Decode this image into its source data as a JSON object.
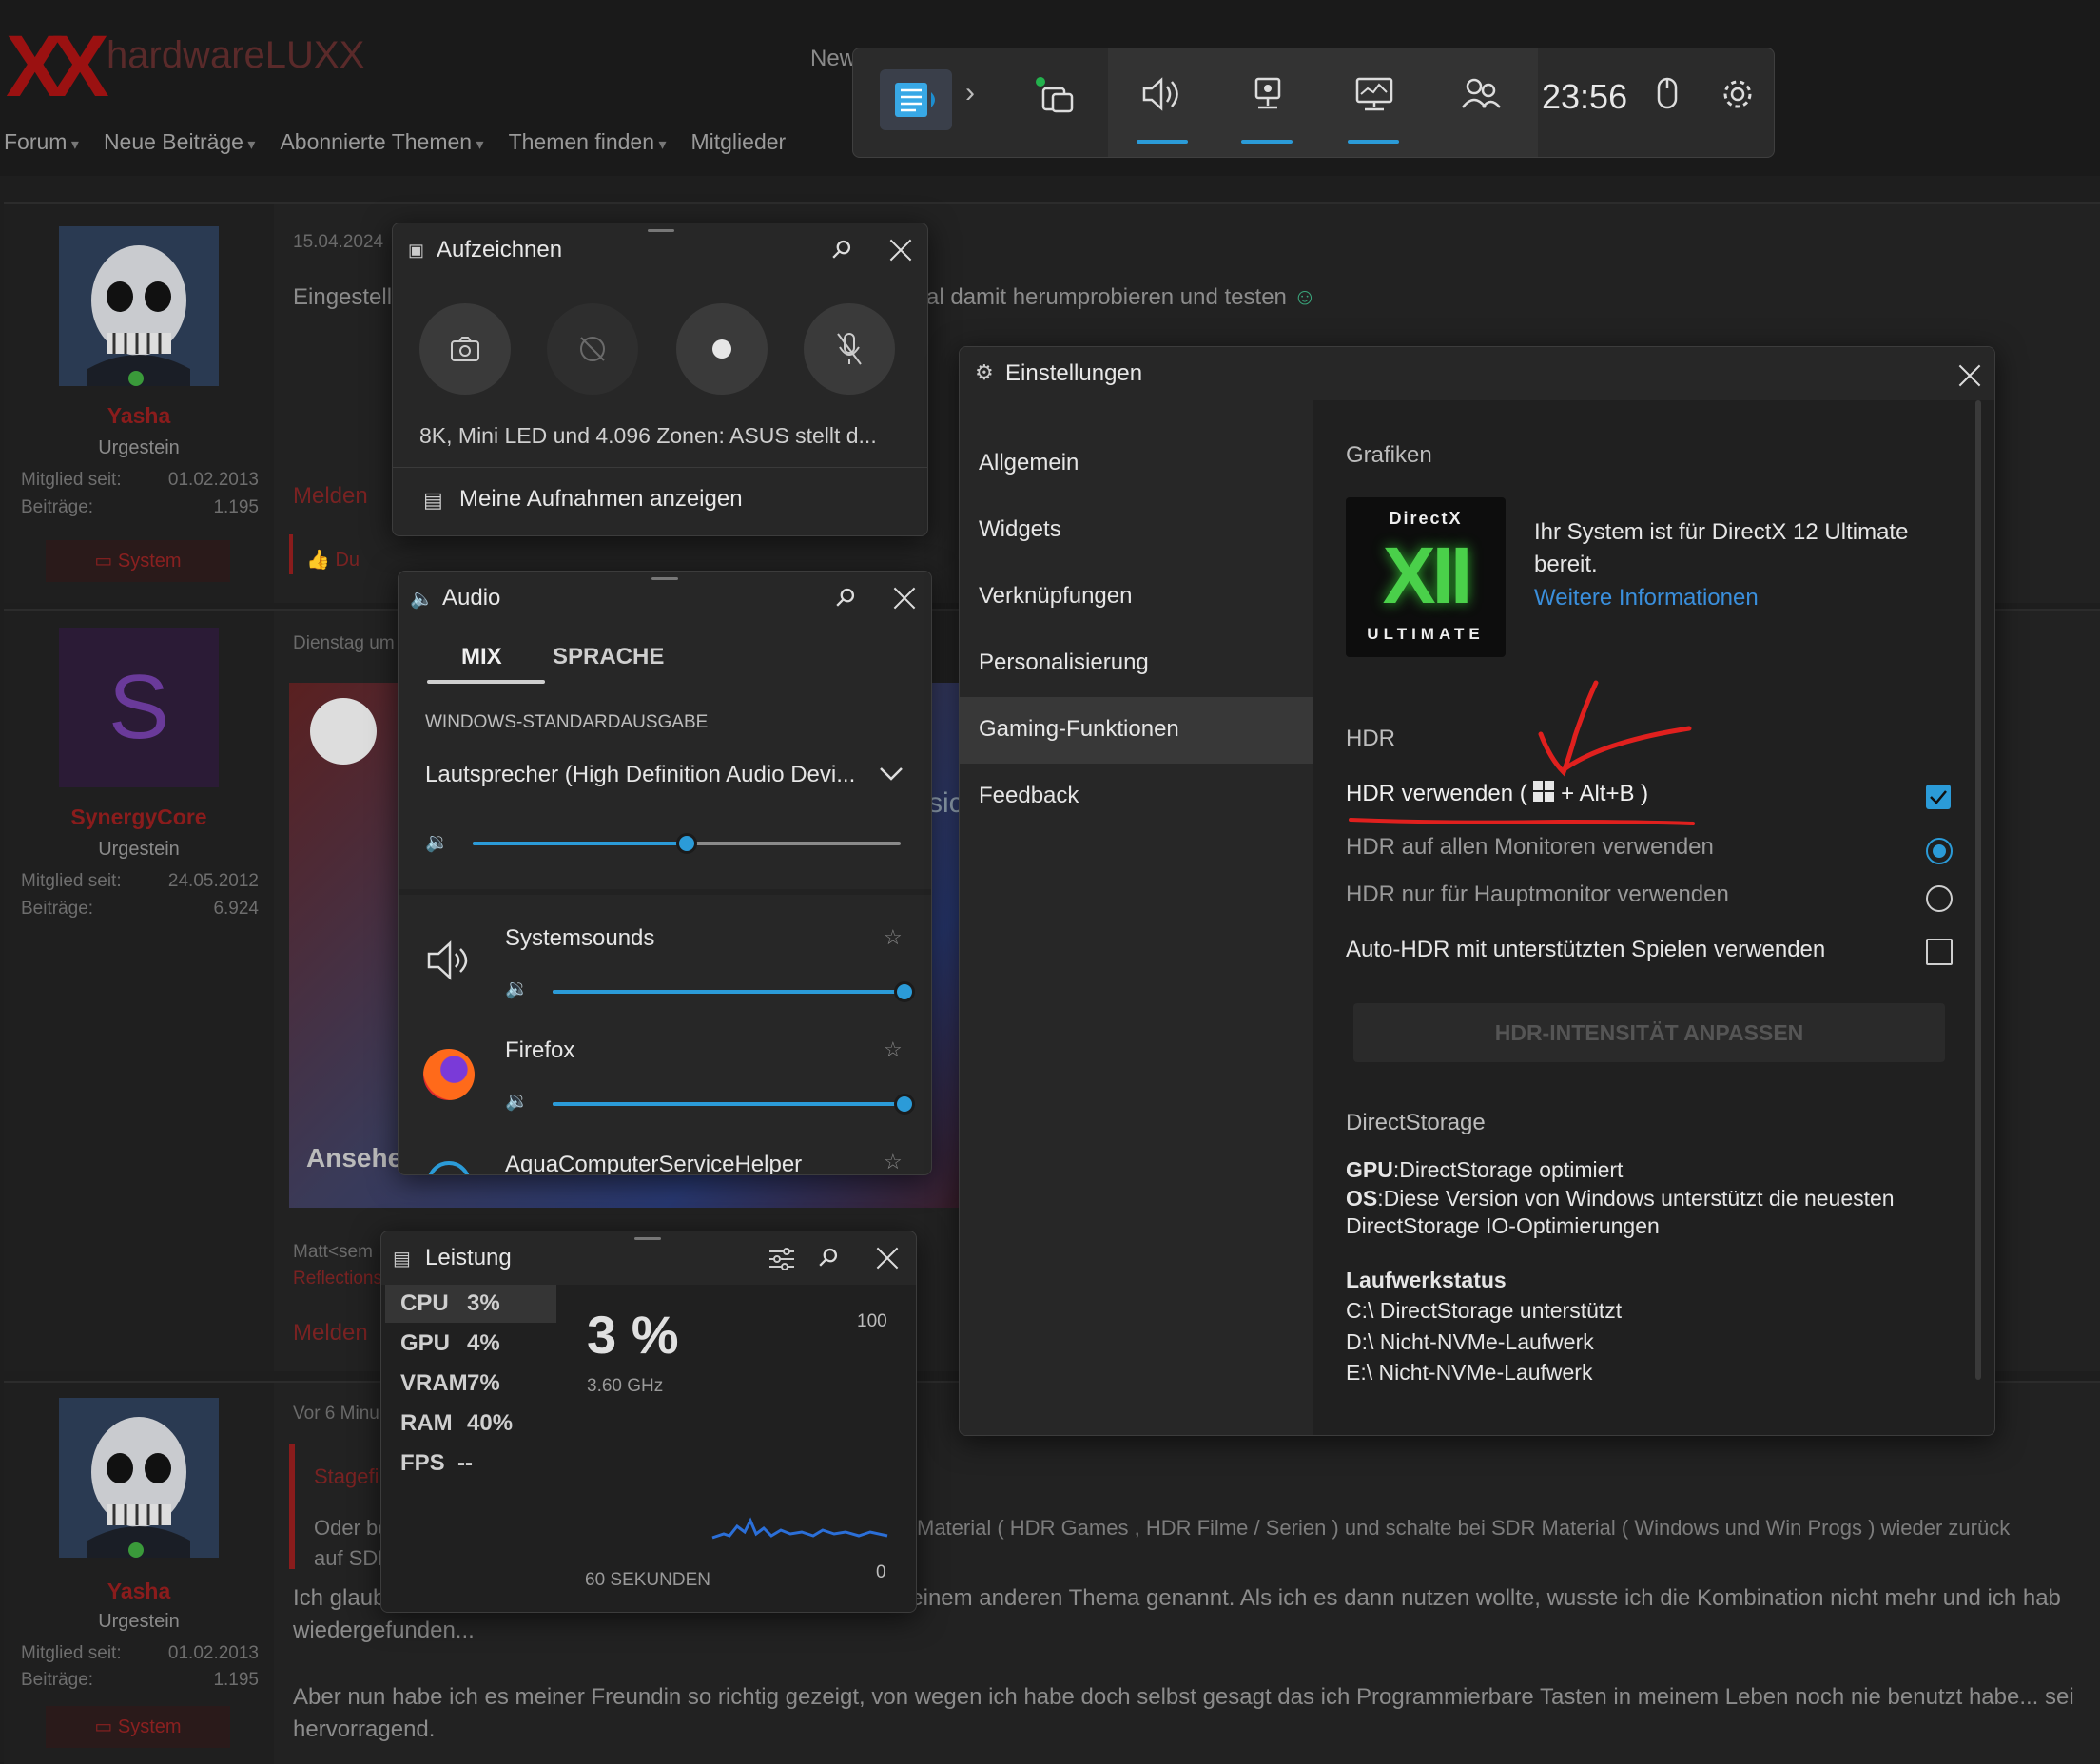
{
  "forum": {
    "logo_suffix": "hardwareLUXX",
    "logo_mark": "XX",
    "top_partial": "New",
    "nav": [
      "Forum",
      "Neue Beiträge",
      "Abonnierte Themen",
      "Themen finden",
      "Mitglieder"
    ],
    "posts": [
      {
        "date": "15.04.2024",
        "text_left": "Eingestellt",
        "text_right": "al damit herumprobieren und testen",
        "user": "Yasha",
        "rank": "Urgestein",
        "member_since_label": "Mitglied seit:",
        "member_since": "01.02.2013",
        "posts_label": "Beiträge:",
        "posts": "1.195",
        "system": "System",
        "melden": "Melden",
        "like": "Du"
      },
      {
        "date": "Dienstag um",
        "user": "SynergyCore",
        "rank": "Urgestein",
        "avatar_letter": "S",
        "member_since_label": "Mitglied seit:",
        "member_since": "24.05.2012",
        "posts_label": "Beiträge:",
        "posts": "6.924",
        "image_caption": "Ansehe",
        "image_partial": "sic",
        "quote_a": "Matt<sem",
        "quote_b": "Reflections",
        "melden": "Melden"
      },
      {
        "date": "Vor 6 Minu",
        "user": "Yasha",
        "rank": "Urgestein",
        "member_since_label": "Mitglied seit:",
        "member_since": "01.02.2013",
        "posts_label": "Beiträge:",
        "posts": "1.195",
        "system": "System",
        "quote_title": "Stagefi",
        "quote_line1_left": "Oder be",
        "quote_line1_right": "Material ( HDR Games , HDR Filme / Serien ) und schalte bei SDR Material ( Windows und Win Progs ) wieder zurück",
        "quote_line2": "auf SDR",
        "para1_line1": "Ich glaube du hattest mir die Tastenkombination schonmal in einem anderen Thema genannt. Als ich es dann nutzen wollte, wusste ich die Kombination nicht mehr und ich hab",
        "para1_line2": "wiedergefunden...",
        "para2_line1": "Aber nun habe ich es meiner Freundin so richtig gezeigt, von wegen ich habe doch selbst gesagt das ich Programmierbare Tasten in meinem Leben noch nie benutzt habe... sei",
        "para2_line2": "hervorragend."
      }
    ]
  },
  "gamebar": {
    "time": "23:56",
    "icons": [
      "widget-menu-icon",
      "chevron-right-icon",
      "resources-icon",
      "audio-icon",
      "capture-icon",
      "performance-icon",
      "social-icon",
      "mouse-icon",
      "settings-icon"
    ]
  },
  "capture": {
    "title": "Aufzeichnen",
    "headline": "8K, Mini LED und 4.096 Zonen: ASUS stellt d...",
    "show_recordings": "Meine Aufnahmen anzeigen"
  },
  "audio": {
    "title": "Audio",
    "tabs": [
      "MIX",
      "SPRACHE"
    ],
    "device_label": "WINDOWS-STANDARDAUSGABE",
    "device": "Lautsprecher (High Definition Audio Devi...",
    "master_volume": 0.5,
    "apps": [
      {
        "name": "Systemsounds",
        "volume": 1.0
      },
      {
        "name": "Firefox",
        "volume": 1.0
      },
      {
        "name": "AquaComputerServiceHelper",
        "volume": 1.0
      }
    ]
  },
  "performance": {
    "title": "Leistung",
    "rows": [
      {
        "label": "CPU",
        "value": "3%"
      },
      {
        "label": "GPU",
        "value": "4%"
      },
      {
        "label": "VRAM",
        "value": "7%"
      },
      {
        "label": "RAM",
        "value": "40%"
      },
      {
        "label": "FPS",
        "value": "--"
      }
    ],
    "big_value": "3 %",
    "freq": "3.60 GHz",
    "max": "100",
    "min": "0",
    "timespan": "60 SEKUNDEN"
  },
  "settings": {
    "title": "Einstellungen",
    "nav": [
      "Allgemein",
      "Widgets",
      "Verknüpfungen",
      "Personalisierung",
      "Gaming-Funktionen",
      "Feedback"
    ],
    "selected_nav": "Gaming-Funktionen",
    "graphics_header": "Grafiken",
    "dx_logo_top": "DirectX",
    "dx_logo_mid": "XII",
    "dx_logo_bottom": "ULTIMATE",
    "dx_text": "Ihr System ist für DirectX 12 Ultimate bereit.",
    "dx_link": "Weitere Informationen",
    "hdr_header": "HDR",
    "hdr_use_prefix": "HDR verwenden (",
    "hdr_use_suffix": "+ Alt+B )",
    "hdr_all": "HDR auf allen Monitoren verwenden",
    "hdr_main": "HDR nur für Hauptmonitor verwenden",
    "auto_hdr": "Auto-HDR mit unterstützten Spielen verwenden",
    "hdr_intensity": "HDR-INTENSITÄT ANPASSEN",
    "ds_header": "DirectStorage",
    "gpu_label": "GPU",
    "gpu_text": ":DirectStorage optimiert",
    "os_label": "OS",
    "os_text_1": ":Diese Version von Windows unterstützt die neuesten",
    "os_text_2": "DirectStorage IO-Optimierungen",
    "drive_header": "Laufwerkstatus",
    "drives": [
      "C:\\ DirectStorage unterstützt",
      "D:\\ Nicht-NVMe-Laufwerk",
      "E:\\ Nicht-NVMe-Laufwerk"
    ]
  },
  "colors": {
    "accent": "#2b9bd8",
    "link": "#3a8fdc",
    "annotation": "#e0201e",
    "forum_red": "#8a1c1c"
  }
}
